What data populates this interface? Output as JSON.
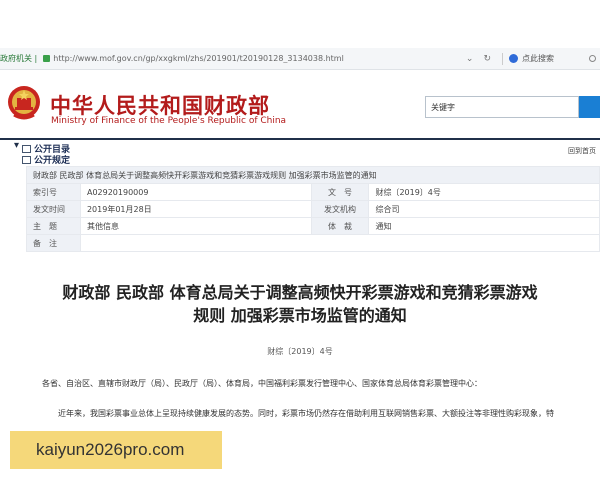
{
  "browser": {
    "tab_fragment": "政府机关 |",
    "url": "http://www.mof.gov.cn/gp/xxgkml/zhs/201901/t20190128_3134038.html",
    "search_engine_label": "点此搜索"
  },
  "header": {
    "title": "中华人民共和国财政部",
    "subtitle": "Ministry of Finance of the People's Republic of China",
    "search_value": "关键字"
  },
  "nav": {
    "items": [
      "公开目录",
      "公开规定"
    ],
    "back_label": "回到首页"
  },
  "meta": {
    "breadcrumb_title": "财政部 民政部 体育总局关于调整高频快开彩票游戏和竞猜彩票游戏规则 加强彩票市场监管的通知",
    "rows": [
      {
        "l1": "索引号",
        "v1": "A02920190009",
        "l2": "文　号",
        "v2": "财综〔2019〕4号"
      },
      {
        "l1": "发文时间",
        "v1": "2019年01月28日",
        "l2": "发文机构",
        "v2": "综合司"
      },
      {
        "l1": "主　题",
        "v1": "其他信息",
        "l2": "体　裁",
        "v2": "通知"
      },
      {
        "l1": "备　注",
        "v1": "",
        "l2": "",
        "v2": ""
      }
    ]
  },
  "article": {
    "title_line1": "财政部 民政部 体育总局关于调整高频快开彩票游戏和竞猜彩票游戏",
    "title_line2": "规则 加强彩票市场监管的通知",
    "doc_number": "财综〔2019〕4号",
    "recipients": "各省、自治区、直辖市财政厅（局）、民政厅（局）、体育局，中国福利彩票发行管理中心、国家体育总局体育彩票管理中心：",
    "body_start": "近年来，我国彩票事业总体上呈现持续健康发展的态势。同时，彩票市场仍然存在借助利用互联网销售彩票、大额投注等非理性购彩现象，特"
  },
  "watermark": {
    "text": "kaiyun2026pro.com"
  },
  "colors": {
    "brand_red": "#b31b1b",
    "nav_dark": "#20304a",
    "search_blue": "#1a7fd4",
    "watermark_yellow": "#f5d87a"
  }
}
